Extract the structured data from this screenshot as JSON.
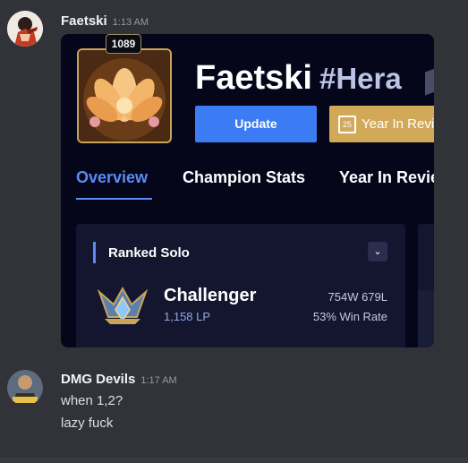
{
  "messages": [
    {
      "username": "Faetski",
      "timestamp": "1:13 AM",
      "embed": {
        "level": "1089",
        "summoner_name": "Faetski",
        "summoner_tag": "#Hera",
        "update_button": "Update",
        "year_in_review_button": "Year In Revi",
        "tabs": [
          "Overview",
          "Champion Stats",
          "Year In Revie"
        ],
        "ranked": {
          "title": "Ranked Solo",
          "tier": "Challenger",
          "lp": "1,158 LP",
          "record": "754W 679L",
          "win_rate": "53% Win Rate"
        }
      }
    },
    {
      "username": "DMG Devils",
      "timestamp": "1:17 AM",
      "lines": [
        "when 1,2?",
        "lazy fuck"
      ]
    }
  ],
  "colors": {
    "background": "#313338",
    "embed_bg": "#05061a",
    "accent_blue": "#3b7cf5",
    "gold": "#d2a959",
    "card": "#14162f"
  }
}
